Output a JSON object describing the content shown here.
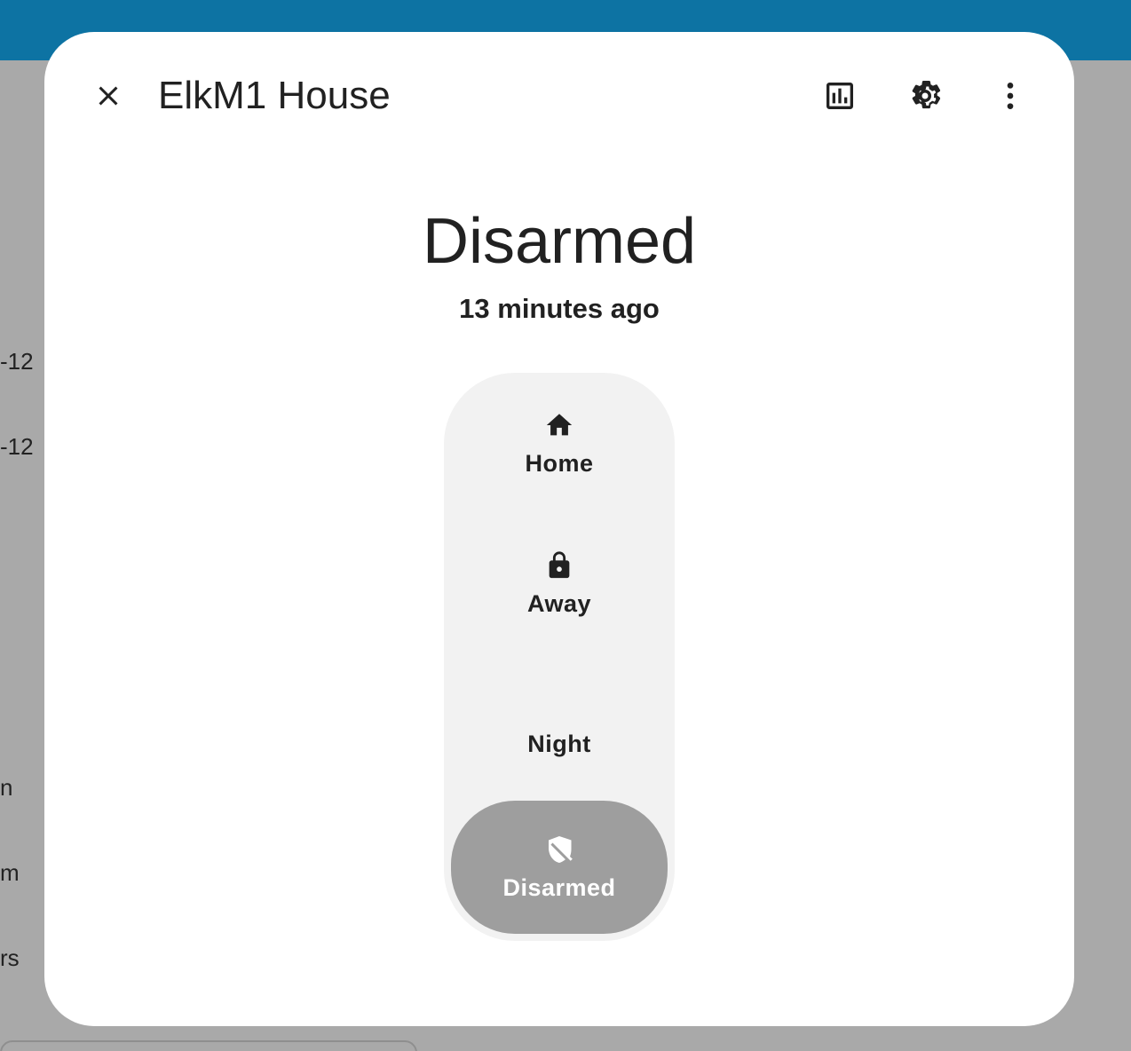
{
  "background": {
    "side_texts": [
      "-12",
      "-12",
      "n",
      "m",
      "rs"
    ]
  },
  "dialog": {
    "title": "ElkM1 House",
    "close_icon": "close-icon",
    "actions": [
      {
        "name": "history",
        "icon": "chart-box-icon"
      },
      {
        "name": "settings",
        "icon": "gear-icon"
      },
      {
        "name": "more",
        "icon": "dots-vertical-icon"
      }
    ],
    "state": "Disarmed",
    "last_changed": "13 minutes ago",
    "modes": [
      {
        "label": "Home",
        "icon": "home-icon",
        "active": false
      },
      {
        "label": "Away",
        "icon": "lock-icon",
        "active": false
      },
      {
        "label": "Night",
        "icon": "moon-icon",
        "active": false
      },
      {
        "label": "Disarmed",
        "icon": "shield-off-icon",
        "active": true
      }
    ]
  },
  "colors": {
    "header": "#0d73a3",
    "backdrop": "#a9a9a9",
    "active_mode": "#9e9e9e",
    "mode_pill": "#f2f2f2"
  }
}
